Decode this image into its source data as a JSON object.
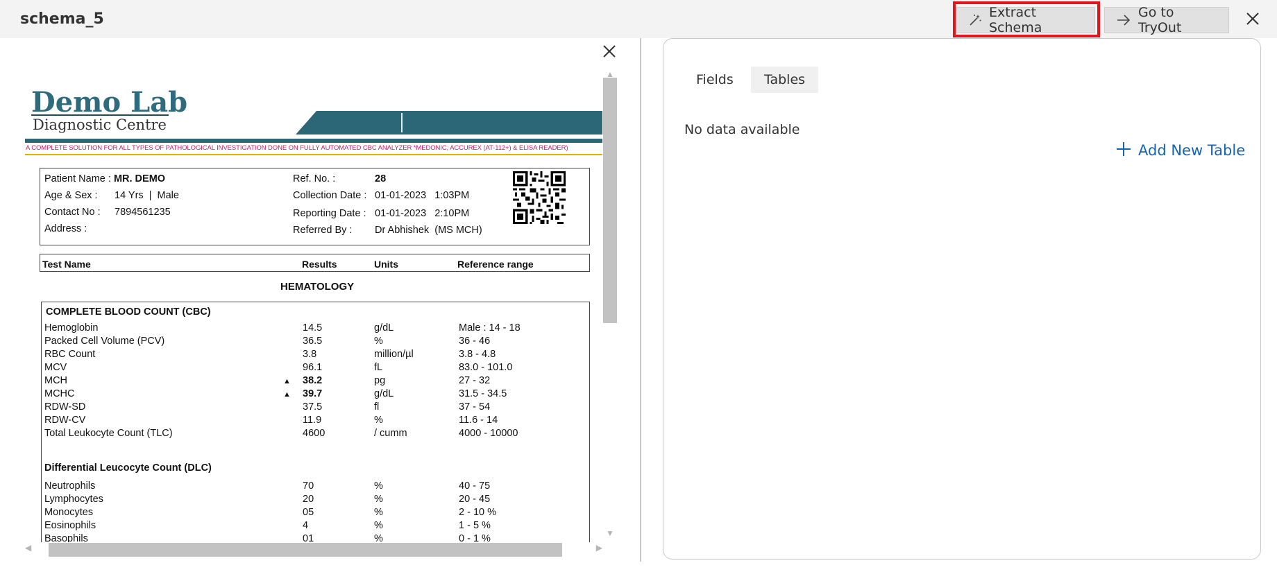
{
  "window": {
    "title": "schema_5"
  },
  "toolbar": {
    "extract_label": "Extract Schema",
    "tryout_label": "Go to TryOut"
  },
  "report": {
    "lab_name": "Demo Lab",
    "lab_sub": "Diagnostic Centre",
    "tagline": "A COMPLETE SOLUTION FOR ALL TYPES OF PATHOLOGICAL INVESTIGATION DONE ON FULLY AUTOMATED CBC ANALYZER *MEDONIC, ACCUREX (AT-112+) & ELISA READER)",
    "patient": {
      "name_label": "Patient Name :",
      "name": "MR. DEMO",
      "age_label": "Age & Sex :",
      "age": "14 Yrs  |  Male",
      "contact_label": "Contact No :",
      "contact": "7894561235",
      "address_label": "Address :",
      "ref_label": "Ref. No. :",
      "ref": "28",
      "collection_label": "Collection Date :",
      "collection": "01-01-2023   1:03PM",
      "reporting_label": "Reporting Date :",
      "reporting": "01-01-2023   2:10PM",
      "referred_label": "Referred By :",
      "referred": "Dr Abhishek  (MS MCH)"
    },
    "headers": {
      "name": "Test Name",
      "results": "Results",
      "units": "Units",
      "range": "Reference range"
    },
    "section": "HEMATOLOGY",
    "cbc_title": "COMPLETE BLOOD COUNT (CBC)",
    "dlc_title": "Differential Leucocyte Count (DLC)",
    "cbc_rows": [
      {
        "name": "Hemoglobin",
        "flag": "",
        "result": "14.5",
        "unit": "g/dL",
        "range": "Male : 14 - 18"
      },
      {
        "name": "Packed Cell Volume (PCV)",
        "flag": "",
        "result": "36.5",
        "unit": "%",
        "range": "36 - 46"
      },
      {
        "name": "RBC Count",
        "flag": "",
        "result": "3.8",
        "unit": "million/µl",
        "range": "3.8 - 4.8"
      },
      {
        "name": "MCV",
        "flag": "",
        "result": "96.1",
        "unit": "fL",
        "range": "83.0 - 101.0"
      },
      {
        "name": "MCH",
        "flag": "▲",
        "result": "38.2",
        "unit": "pg",
        "range": "27 - 32"
      },
      {
        "name": "MCHC",
        "flag": "▲",
        "result": "39.7",
        "unit": "g/dL",
        "range": "31.5 - 34.5"
      },
      {
        "name": "RDW-SD",
        "flag": "",
        "result": "37.5",
        "unit": "fl",
        "range": "37 - 54"
      },
      {
        "name": "RDW-CV",
        "flag": "",
        "result": "11.9",
        "unit": "%",
        "range": "11.6 - 14"
      },
      {
        "name": "Total Leukocyte Count (TLC)",
        "flag": "",
        "result": "4600",
        "unit": "/ cumm",
        "range": "4000 - 10000"
      }
    ],
    "dlc_rows": [
      {
        "name": "Neutrophils",
        "result": "70",
        "unit": "%",
        "range": "40 - 75"
      },
      {
        "name": "Lymphocytes",
        "result": "20",
        "unit": "%",
        "range": "20 - 45"
      },
      {
        "name": "Monocytes",
        "result": "05",
        "unit": "%",
        "range": "2 - 10 %"
      },
      {
        "name": "Eosinophils",
        "result": "4",
        "unit": "%",
        "range": "1 - 5 %"
      },
      {
        "name": "Basophils",
        "result": "01",
        "unit": "%",
        "range": "0 - 1 %"
      }
    ]
  },
  "panel": {
    "tabs": [
      "Fields",
      "Tables"
    ],
    "active_tab": "Tables",
    "empty_message": "No data available",
    "add_table_label": "Add New Table"
  },
  "colors": {
    "accent": "#1264b8",
    "highlight": "#e3141c",
    "brand": "#2e6b7c"
  },
  "icons": {
    "extract": "magic-wand-icon",
    "tryout": "arrow-right-icon",
    "close": "close-icon",
    "add": "plus-icon"
  }
}
